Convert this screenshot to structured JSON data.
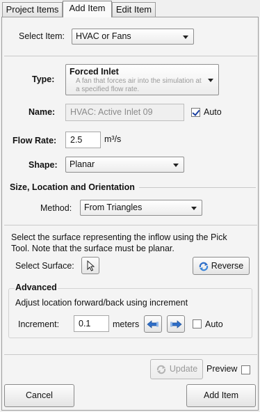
{
  "tabs": [
    {
      "label": "Project Items"
    },
    {
      "label": "Add Item"
    },
    {
      "label": "Edit Item"
    }
  ],
  "select_item": {
    "label": "Select Item:",
    "value": "HVAC or Fans"
  },
  "type": {
    "label": "Type:",
    "title": "Forced Inlet",
    "description": "A fan that forces air into the simulation at a specified flow rate."
  },
  "name": {
    "label": "Name:",
    "value": "HVAC: Active Inlet 09",
    "auto_label": "Auto",
    "auto_checked": true
  },
  "flow_rate": {
    "label": "Flow Rate:",
    "value": "2.5",
    "unit": "m³/s"
  },
  "shape": {
    "label": "Shape:",
    "value": "Planar"
  },
  "size_section": {
    "heading": "Size, Location and Orientation",
    "method_label": "Method:",
    "method_value": "From Triangles",
    "instructions": "Select the surface representing the inflow using the Pick Tool. Note that the surface must be planar.",
    "select_surface_label": "Select Surface:",
    "reverse_label": "Reverse"
  },
  "advanced": {
    "heading": "Advanced",
    "description": "Adjust location forward/back using increment",
    "increment_label": "Increment:",
    "increment_value": "0.1",
    "increment_unit": "meters",
    "auto_label": "Auto",
    "auto_checked": false
  },
  "footer": {
    "update_label": "Update",
    "preview_label": "Preview",
    "preview_checked": false,
    "cancel_label": "Cancel",
    "add_item_label": "Add Item"
  },
  "colors": {
    "arrow_blue": "#2f6fc9",
    "update_green": "#3a8f3a"
  }
}
